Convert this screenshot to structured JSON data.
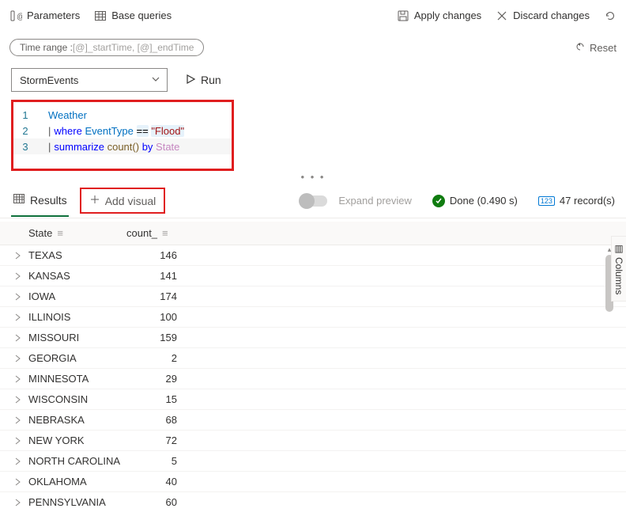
{
  "toolbar": {
    "parameters": "Parameters",
    "base_queries": "Base queries",
    "apply_changes": "Apply changes",
    "discard_changes": "Discard changes"
  },
  "time_range": {
    "prefix": "Time range :",
    "params": " [@]_startTime, [@]_endTime"
  },
  "reset_label": "Reset",
  "source_select": {
    "value": "StormEvents"
  },
  "run_button": "Run",
  "editor": {
    "lines": [
      {
        "n": "1",
        "raw": "Weather"
      },
      {
        "n": "2",
        "raw": "| where EventType == \"Flood\""
      },
      {
        "n": "3",
        "raw": "| summarize count() by State"
      }
    ]
  },
  "tabs": {
    "results": "Results",
    "add_visual": "Add visual",
    "expand_preview": "Expand preview",
    "columns_panel": "Columns"
  },
  "status": {
    "label": "Done (0.490 s)",
    "records": "47 record(s)"
  },
  "table": {
    "headers": {
      "state": "State",
      "count": "count_"
    },
    "rows": [
      {
        "state": "TEXAS",
        "count": "146"
      },
      {
        "state": "KANSAS",
        "count": "141"
      },
      {
        "state": "IOWA",
        "count": "174"
      },
      {
        "state": "ILLINOIS",
        "count": "100"
      },
      {
        "state": "MISSOURI",
        "count": "159"
      },
      {
        "state": "GEORGIA",
        "count": "2"
      },
      {
        "state": "MINNESOTA",
        "count": "29"
      },
      {
        "state": "WISCONSIN",
        "count": "15"
      },
      {
        "state": "NEBRASKA",
        "count": "68"
      },
      {
        "state": "NEW YORK",
        "count": "72"
      },
      {
        "state": "NORTH CAROLINA",
        "count": "5"
      },
      {
        "state": "OKLAHOMA",
        "count": "40"
      },
      {
        "state": "PENNSYLVANIA",
        "count": "60"
      }
    ]
  }
}
